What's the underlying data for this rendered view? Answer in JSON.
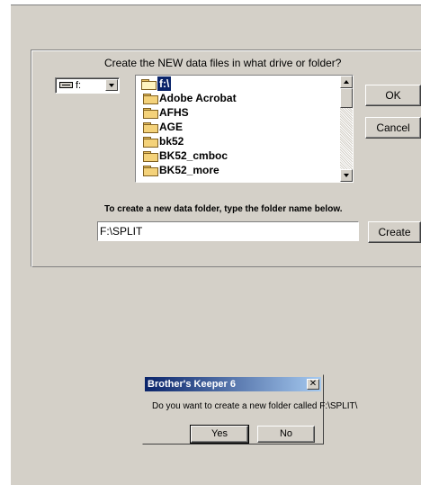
{
  "dialog": {
    "prompt": "Create the NEW data files in what drive or folder?",
    "drive": {
      "label": "f:"
    },
    "folders": [
      {
        "label": "f:\\",
        "icon": "open-folder-icon",
        "selected": true
      },
      {
        "label": "Adobe Acrobat",
        "icon": "folder-icon"
      },
      {
        "label": "AFHS",
        "icon": "folder-icon"
      },
      {
        "label": "AGE",
        "icon": "folder-icon"
      },
      {
        "label": "bk52",
        "icon": "folder-icon"
      },
      {
        "label": "BK52_cmboc",
        "icon": "folder-icon"
      },
      {
        "label": "BK52_more",
        "icon": "folder-icon"
      }
    ],
    "ok_label": "OK",
    "cancel_label": "Cancel",
    "hint": "To create a new data folder, type the folder name below.",
    "folder_name_value": "F:\\SPLIT",
    "create_label": "Create"
  },
  "messagebox": {
    "title": "Brother's Keeper 6",
    "message": "Do you want to create a new folder called F:\\SPLIT\\",
    "yes_label": "Yes",
    "no_label": "No"
  },
  "colors": {
    "face": "#d4d0c8",
    "selection": "#0a246a",
    "titlebar_start": "#0a246a",
    "titlebar_end": "#a6caf0"
  }
}
